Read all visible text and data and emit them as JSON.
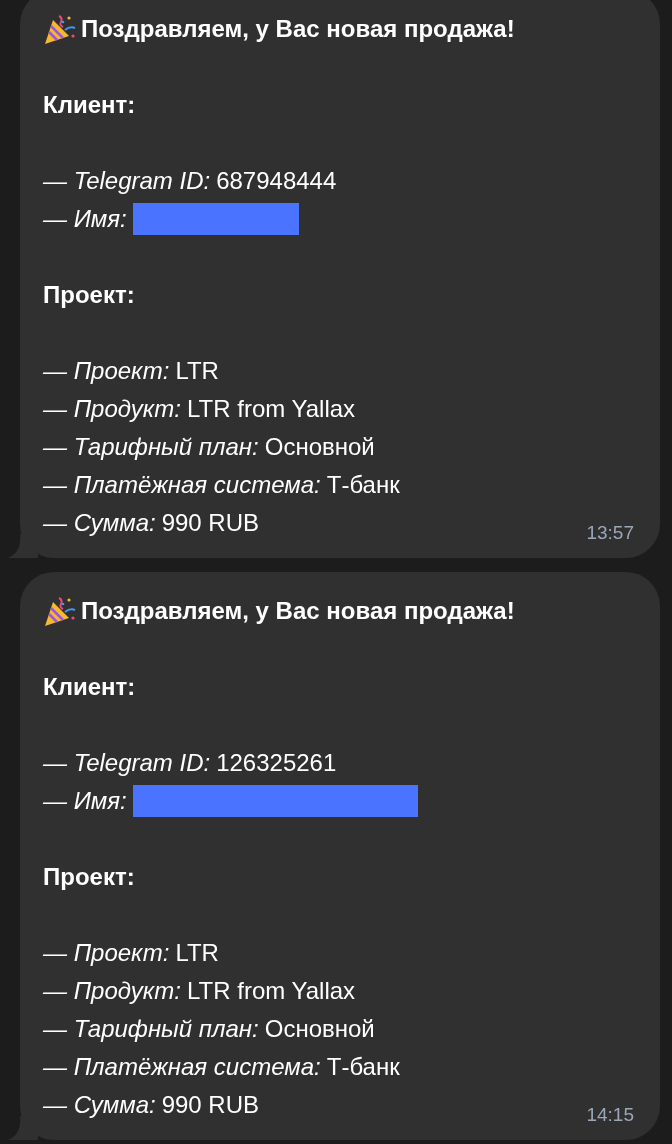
{
  "messages": [
    {
      "title": "Поздравляем, у Вас новая продажа!",
      "time": "13:57",
      "lines": [
        {
          "kind": "section",
          "text": "Клиент:"
        },
        {
          "kind": "field",
          "label": "— Telegram ID:",
          "value": "687948444"
        },
        {
          "kind": "redacted",
          "label": "— Имя:"
        },
        {
          "kind": "section",
          "text": "Проект:"
        },
        {
          "kind": "field",
          "label": "— Проект:",
          "value": "LTR"
        },
        {
          "kind": "field",
          "label": "— Продукт:",
          "value": "LTR from Yallax"
        },
        {
          "kind": "field",
          "label": "— Тарифный план:",
          "value": "Основной"
        },
        {
          "kind": "field",
          "label": "— Платёжная система:",
          "value": "Т-банк"
        },
        {
          "kind": "field",
          "label": "— Сумма:",
          "value": "990 RUB"
        }
      ]
    },
    {
      "title": "Поздравляем, у Вас новая продажа!",
      "time": "14:15",
      "lines": [
        {
          "kind": "section",
          "text": "Клиент:"
        },
        {
          "kind": "field",
          "label": "— Telegram ID:",
          "value": "126325261"
        },
        {
          "kind": "redacted",
          "label": "— Имя:"
        },
        {
          "kind": "section",
          "text": "Проект:"
        },
        {
          "kind": "field",
          "label": "— Проект:",
          "value": "LTR"
        },
        {
          "kind": "field",
          "label": "— Продукт:",
          "value": "LTR from Yallax"
        },
        {
          "kind": "field",
          "label": "— Тарифный план:",
          "value": "Основной"
        },
        {
          "kind": "field",
          "label": "— Платёжная система:",
          "value": "Т-банк"
        },
        {
          "kind": "field",
          "label": "— Сумма:",
          "value": "990 RUB"
        }
      ]
    }
  ]
}
